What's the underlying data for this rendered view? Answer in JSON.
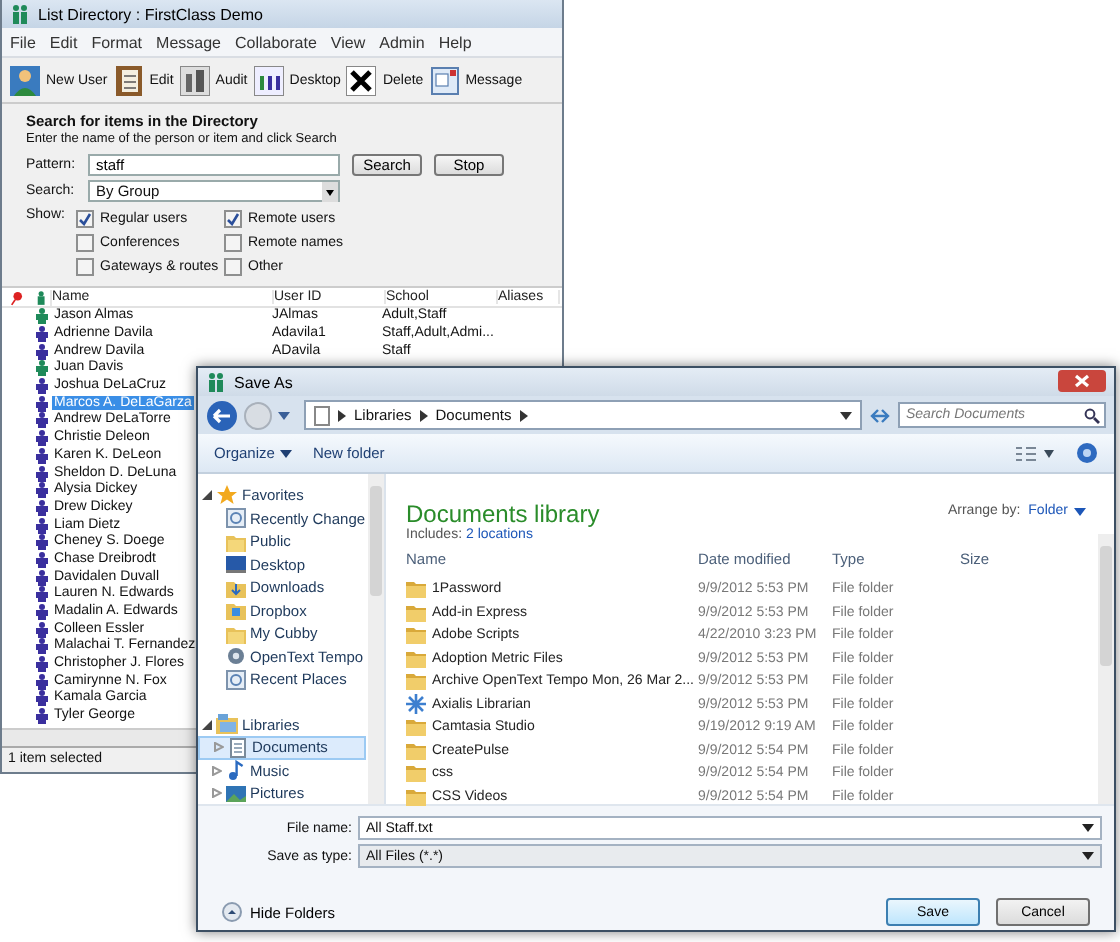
{
  "list_window": {
    "title": "List Directory : FirstClass Demo",
    "menu": [
      "File",
      "Edit",
      "Format",
      "Message",
      "Collaborate",
      "View",
      "Admin",
      "Help"
    ],
    "toolbar": [
      "New User",
      "Edit",
      "Audit",
      "Desktop",
      "Delete",
      "Message"
    ],
    "search": {
      "heading": "Search for items in the Directory",
      "hint": "Enter the name of the person or item and click Search",
      "pattern_label": "Pattern:",
      "pattern": "staff",
      "search_button": "Search",
      "stop_button": "Stop",
      "search_label": "Search:",
      "search_by": "By Group",
      "show_label": "Show:",
      "filters": [
        {
          "label": "Regular users",
          "checked": true
        },
        {
          "label": "Remote users",
          "checked": true
        },
        {
          "label": "Conferences",
          "checked": false
        },
        {
          "label": "Remote names",
          "checked": false
        },
        {
          "label": "Gateways & routes",
          "checked": false
        },
        {
          "label": "Other",
          "checked": false
        }
      ]
    },
    "columns": [
      "Name",
      "User ID",
      "School",
      "Aliases"
    ],
    "rows": [
      {
        "name": "Jason Almas",
        "user_id": "JAlmas",
        "school": "Adult,Staff",
        "selected": false,
        "color": "#1f8a5a"
      },
      {
        "name": "Adrienne Davila",
        "user_id": "Adavila1",
        "school": "Staff,Adult,Admi...",
        "selected": false,
        "color": "#3a2f9e"
      },
      {
        "name": "Andrew Davila",
        "user_id": "ADavila",
        "school": "Staff",
        "selected": false,
        "color": "#3a2f9e"
      },
      {
        "name": "Juan Davis",
        "selected": false,
        "color": "#1f8a5a"
      },
      {
        "name": "Joshua DeLaCruz",
        "selected": false,
        "color": "#3a2f9e"
      },
      {
        "name": "Marcos A. DeLaGarza",
        "selected": true,
        "color": "#3a2f9e"
      },
      {
        "name": "Andrew DeLaTorre",
        "selected": false,
        "color": "#3a2f9e"
      },
      {
        "name": "Christie Deleon",
        "selected": false,
        "color": "#3a2f9e"
      },
      {
        "name": "Karen K. DeLeon",
        "selected": false,
        "color": "#3a2f9e"
      },
      {
        "name": "Sheldon D. DeLuna",
        "selected": false,
        "color": "#3a2f9e"
      },
      {
        "name": "Alysia Dickey",
        "selected": false,
        "color": "#3a2f9e"
      },
      {
        "name": "Drew Dickey",
        "selected": false,
        "color": "#3a2f9e"
      },
      {
        "name": "Liam Dietz",
        "selected": false,
        "color": "#3a2f9e"
      },
      {
        "name": "Cheney S. Doege",
        "selected": false,
        "color": "#3a2f9e"
      },
      {
        "name": "Chase Dreibrodt",
        "selected": false,
        "color": "#3a2f9e"
      },
      {
        "name": "Davidalen Duvall",
        "selected": false,
        "color": "#3a2f9e"
      },
      {
        "name": "Lauren N. Edwards",
        "selected": false,
        "color": "#3a2f9e"
      },
      {
        "name": "Madalin A. Edwards",
        "selected": false,
        "color": "#3a2f9e"
      },
      {
        "name": "Colleen Essler",
        "selected": false,
        "color": "#3a2f9e"
      },
      {
        "name": "Malachai T. Fernandez",
        "selected": false,
        "color": "#3a2f9e"
      },
      {
        "name": "Christopher J. Flores",
        "selected": false,
        "color": "#3a2f9e"
      },
      {
        "name": "Camirynne N. Fox",
        "selected": false,
        "color": "#3a2f9e"
      },
      {
        "name": "Kamala Garcia",
        "selected": false,
        "color": "#3a2f9e"
      },
      {
        "name": "Tyler George",
        "selected": false,
        "color": "#3a2f9e"
      }
    ],
    "status_bar": "1 item selected"
  },
  "save_dialog": {
    "title": "Save As",
    "breadcrumb": [
      "Libraries",
      "Documents"
    ],
    "search": {
      "placeholder": "Search Documents"
    },
    "toolbar": {
      "organize": "Organize",
      "new_folder": "New folder"
    },
    "nav": [
      {
        "label": "Favorites",
        "kind": "star",
        "expanded": true,
        "children": [
          {
            "label": "Recently Change",
            "kind": "recent"
          },
          {
            "label": "Public",
            "kind": "folder"
          },
          {
            "label": "Desktop",
            "kind": "desktop"
          },
          {
            "label": "Downloads",
            "kind": "download"
          },
          {
            "label": "Dropbox",
            "kind": "dropbox"
          },
          {
            "label": "My Cubby",
            "kind": "folder"
          },
          {
            "label": "OpenText Tempo",
            "kind": "gear"
          },
          {
            "label": "Recent Places",
            "kind": "recent"
          }
        ]
      },
      {
        "label": "Libraries",
        "kind": "library",
        "expanded": true,
        "children": [
          {
            "label": "Documents",
            "kind": "document",
            "expanded": false,
            "selected": true
          },
          {
            "label": "Music",
            "kind": "music",
            "expanded": false,
            "selected": false
          },
          {
            "label": "Pictures",
            "kind": "picture",
            "expanded": false,
            "selected": false
          }
        ]
      }
    ],
    "library_title": "Documents library",
    "includes_label": "Includes:",
    "includes_link": "2 locations",
    "arrange_label": "Arrange by:",
    "arrange_value": "Folder",
    "columns": [
      "Name",
      "Date modified",
      "Type",
      "Size"
    ],
    "files": [
      {
        "name": "1Password",
        "date": "9/9/2012 5:53 PM",
        "type": "File folder",
        "kind": "folder"
      },
      {
        "name": "Add-in Express",
        "date": "9/9/2012 5:53 PM",
        "type": "File folder",
        "kind": "folder"
      },
      {
        "name": "Adobe Scripts",
        "date": "4/22/2010 3:23 PM",
        "type": "File folder",
        "kind": "folder"
      },
      {
        "name": "Adoption Metric Files",
        "date": "9/9/2012 5:53 PM",
        "type": "File folder",
        "kind": "folder"
      },
      {
        "name": "Archive OpenText Tempo Mon, 26 Mar 2...",
        "date": "9/9/2012 5:53 PM",
        "type": "File folder",
        "kind": "folder"
      },
      {
        "name": "Axialis Librarian",
        "date": "9/9/2012 5:53 PM",
        "type": "File folder",
        "kind": "app"
      },
      {
        "name": "Camtasia Studio",
        "date": "9/19/2012 9:19 AM",
        "type": "File folder",
        "kind": "folder"
      },
      {
        "name": "CreatePulse",
        "date": "9/9/2012 5:54 PM",
        "type": "File folder",
        "kind": "folder"
      },
      {
        "name": "css",
        "date": "9/9/2012 5:54 PM",
        "type": "File folder",
        "kind": "folder"
      },
      {
        "name": "CSS Videos",
        "date": "9/9/2012 5:54 PM",
        "type": "File folder",
        "kind": "folder"
      }
    ],
    "file_name_label": "File name:",
    "file_name": "All Staff.txt",
    "type_label": "Save as type:",
    "type_value": "All Files (*.*)",
    "hide_folders": "Hide Folders",
    "buttons": [
      "Save",
      "Cancel"
    ]
  }
}
